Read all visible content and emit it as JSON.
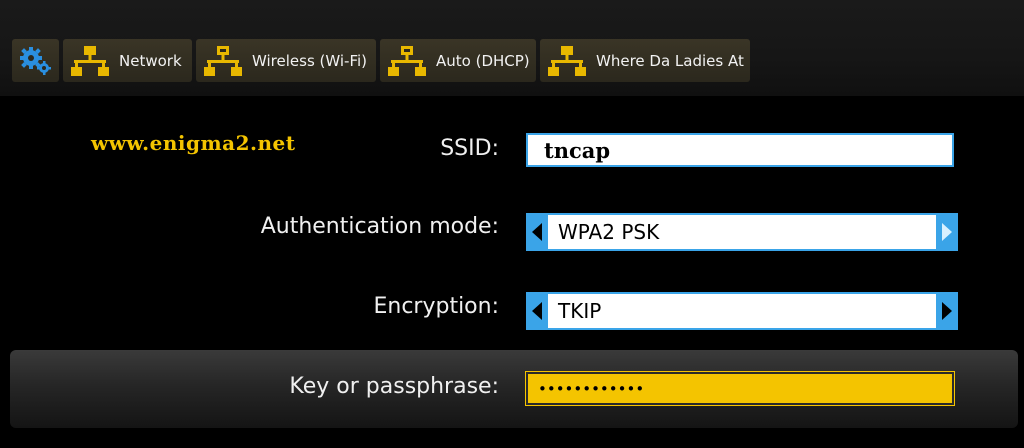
{
  "breadcrumbs": [
    {
      "label": "Network",
      "icon": "network-icon"
    },
    {
      "label": "Wireless (Wi-Fi)",
      "icon": "network-icon"
    },
    {
      "label": "Auto (DHCP)",
      "icon": "network-icon"
    },
    {
      "label": "Where Da Ladies At",
      "icon": "network-icon"
    }
  ],
  "watermark": "www.enigma2.net",
  "form": {
    "ssid": {
      "label": "SSID:",
      "value": "tncap"
    },
    "auth_mode": {
      "label": "Authentication mode:",
      "value": "WPA2 PSK"
    },
    "encryption": {
      "label": "Encryption:",
      "value": "TKIP"
    },
    "passphrase": {
      "label": "Key or passphrase:",
      "value": "••••••••••••"
    }
  },
  "colors": {
    "accent_blue": "#3aa4e8",
    "highlight_yellow": "#f4c400",
    "icon_yellow": "#e8b800"
  }
}
